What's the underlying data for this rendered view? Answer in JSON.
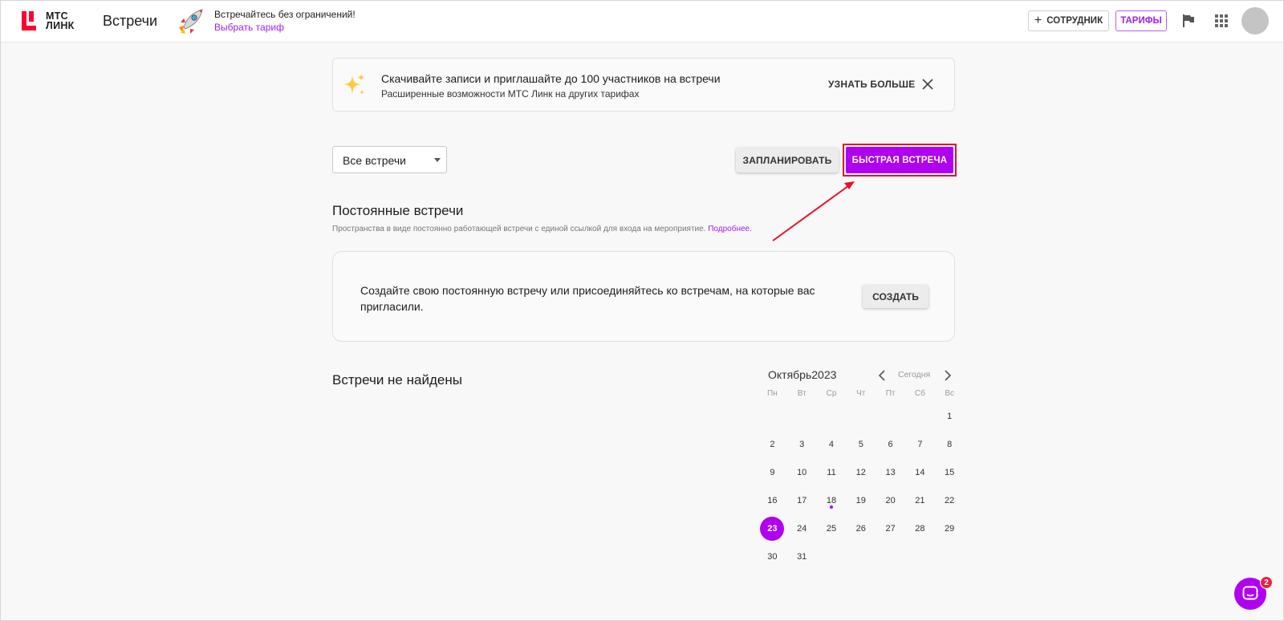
{
  "header": {
    "logo_text_line1": "МТС",
    "logo_text_line2": "ЛИНК",
    "app_title": "Встречи",
    "promo_title": "Встречайтесь без ограничений!",
    "promo_link": "Выбрать тариф",
    "employee_button": "СОТРУДНИК",
    "tariffs_button": "ТАРИФЫ"
  },
  "banner": {
    "title": "Скачивайте записи и приглашайте до 100 участников на встречи",
    "subtitle": "Расширенные возможности МТС Линк на других тарифах",
    "more_label": "УЗНАТЬ БОЛЬШЕ"
  },
  "controls": {
    "filter_value": "Все встречи",
    "plan_button": "ЗАПЛАНИРОВАТЬ",
    "quick_button": "БЫСТРАЯ ВСТРЕЧА"
  },
  "permanent": {
    "title": "Постоянные встречи",
    "description": "Пространства в виде постоянно работающей встречи с единой ссылкой для входа на мероприятие.",
    "more_link": "Подробнее.",
    "card_text": "Создайте свою постоянную встречу или присоединяйтесь ко встречам, на которые вас пригласили.",
    "create_button": "СОЗДАТЬ"
  },
  "empty_state": {
    "title": "Встречи не найдены"
  },
  "calendar": {
    "month_label": "Октябрь2023",
    "today_label": "Сегодня",
    "weekdays": [
      "Пн",
      "Вт",
      "Ср",
      "Чт",
      "Пт",
      "Сб",
      "Вс"
    ],
    "leading_blanks": 6,
    "days_in_month": 31,
    "selected_day": 23,
    "marked_days": [
      18
    ]
  },
  "chat": {
    "badge_count": "2"
  },
  "colors": {
    "accent": "#b000f0",
    "annotation_red": "#e8102a"
  }
}
